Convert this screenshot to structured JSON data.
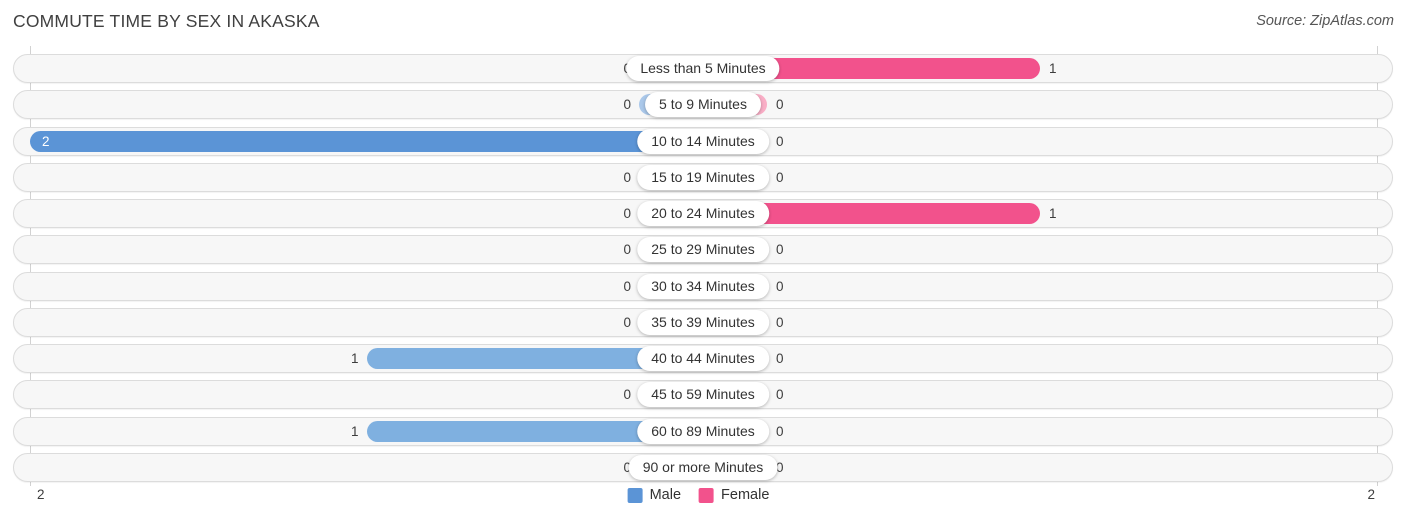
{
  "header": {
    "title": "COMMUTE TIME BY SEX IN AKASKA",
    "source": "Source: ZipAtlas.com"
  },
  "legend": {
    "male_label": "Male",
    "female_label": "Female",
    "male_color": "#5b94d6",
    "female_color": "#f2528c"
  },
  "axis": {
    "left_tick": "2",
    "right_tick": "2"
  },
  "colors": {
    "male_full": "#5b94d6",
    "male_one": "#7fb0e0",
    "male_zero": "#aac8ea",
    "female_one": "#f2528c",
    "female_zero": "#f9aec6",
    "track_bg": "#f7f7f7",
    "track_border": "#dcdcdc",
    "gridline": "#d2d2d2"
  },
  "chart_data": {
    "type": "bar",
    "title": "COMMUTE TIME BY SEX IN AKASKA",
    "subtitle": "",
    "orientation": "horizontal-diverging",
    "xlabel": "",
    "ylabel": "",
    "xlim": [
      2,
      2
    ],
    "grid": true,
    "legend_position": "bottom-center",
    "categories": [
      "Less than 5 Minutes",
      "5 to 9 Minutes",
      "10 to 14 Minutes",
      "15 to 19 Minutes",
      "20 to 24 Minutes",
      "25 to 29 Minutes",
      "30 to 34 Minutes",
      "35 to 39 Minutes",
      "40 to 44 Minutes",
      "45 to 59 Minutes",
      "60 to 89 Minutes",
      "90 or more Minutes"
    ],
    "series": [
      {
        "name": "Male",
        "values": [
          0,
          0,
          2,
          0,
          0,
          0,
          0,
          0,
          1,
          0,
          1,
          0
        ]
      },
      {
        "name": "Female",
        "values": [
          1,
          0,
          0,
          0,
          1,
          0,
          0,
          0,
          0,
          0,
          0,
          0
        ]
      }
    ]
  },
  "rows": [
    {
      "category": "Less than 5 Minutes",
      "male": "0",
      "female": "1"
    },
    {
      "category": "5 to 9 Minutes",
      "male": "0",
      "female": "0"
    },
    {
      "category": "10 to 14 Minutes",
      "male": "2",
      "female": "0"
    },
    {
      "category": "15 to 19 Minutes",
      "male": "0",
      "female": "0"
    },
    {
      "category": "20 to 24 Minutes",
      "male": "0",
      "female": "1"
    },
    {
      "category": "25 to 29 Minutes",
      "male": "0",
      "female": "0"
    },
    {
      "category": "30 to 34 Minutes",
      "male": "0",
      "female": "0"
    },
    {
      "category": "35 to 39 Minutes",
      "male": "0",
      "female": "0"
    },
    {
      "category": "40 to 44 Minutes",
      "male": "1",
      "female": "0"
    },
    {
      "category": "45 to 59 Minutes",
      "male": "0",
      "female": "0"
    },
    {
      "category": "60 to 89 Minutes",
      "male": "1",
      "female": "0"
    },
    {
      "category": "90 or more Minutes",
      "male": "0",
      "female": "0"
    }
  ]
}
